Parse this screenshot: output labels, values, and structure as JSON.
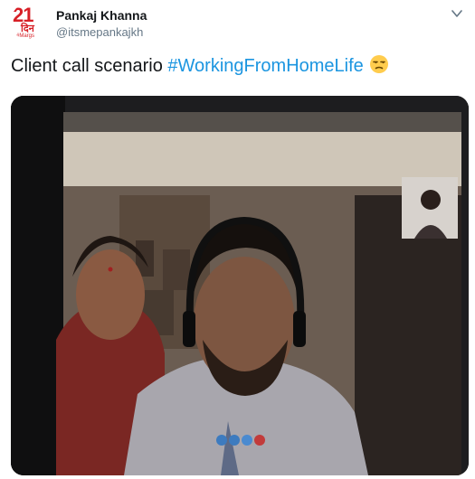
{
  "author": {
    "name": "Pankaj Khanna",
    "handle": "@itsmepankajkh",
    "avatar_number": "21",
    "avatar_script": "दिन",
    "avatar_tag": "#Margs"
  },
  "tweet": {
    "text": "Client call scenario ",
    "hashtag": "#WorkingFromHomeLife",
    "emoji": "unamused-face-icon"
  },
  "photo": {
    "description_icon": "video-call-photo"
  },
  "colors": {
    "text": "#14171a",
    "muted": "#657786",
    "link": "#1b95e0",
    "avatar_red": "#d71f26"
  }
}
